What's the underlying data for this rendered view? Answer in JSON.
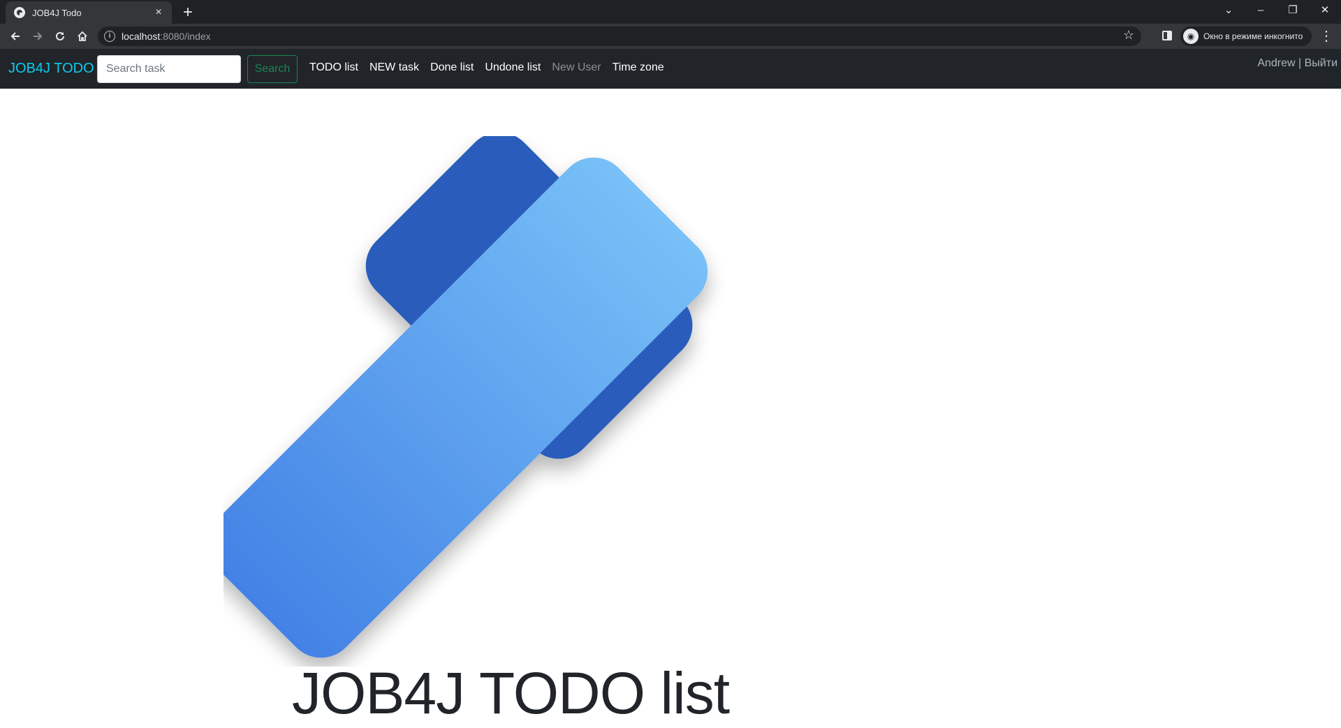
{
  "browser": {
    "tab_title": "JOB4J Todo",
    "tab_close": "×",
    "new_tab": "+",
    "url_host": "localhost",
    "url_rest": ":8080/index",
    "incognito_label": "Окно в режиме инкогнито",
    "window_controls": [
      "⌄",
      "–",
      "❐",
      "✕"
    ],
    "icons": {
      "back": "back-arrow-icon",
      "forward": "forward-arrow-icon",
      "reload": "reload-icon",
      "home": "home-icon",
      "info": "info-icon",
      "bookmark": "star-icon",
      "menu": "kebab-menu-icon"
    }
  },
  "navbar": {
    "brand": "JOB4J TODO",
    "search_placeholder": "Search task",
    "search_button": "Search",
    "links": [
      {
        "label": "TODO list",
        "muted": false
      },
      {
        "label": "NEW task",
        "muted": false
      },
      {
        "label": "Done list",
        "muted": false
      },
      {
        "label": "Undone list",
        "muted": false
      },
      {
        "label": "New User",
        "muted": true
      },
      {
        "label": "Time zone",
        "muted": false
      }
    ],
    "user": {
      "name": "Andrew",
      "separator": " | ",
      "logout": "Выйти"
    }
  },
  "main": {
    "title": "JOB4J TODO list"
  },
  "colors": {
    "navbar_bg": "#212529",
    "brand": "#0dcaf0",
    "search_btn": "#198754",
    "logo_dark": "#2c5bbb",
    "logo_light_start": "#78c0f7",
    "logo_light_end": "#4382e5"
  }
}
